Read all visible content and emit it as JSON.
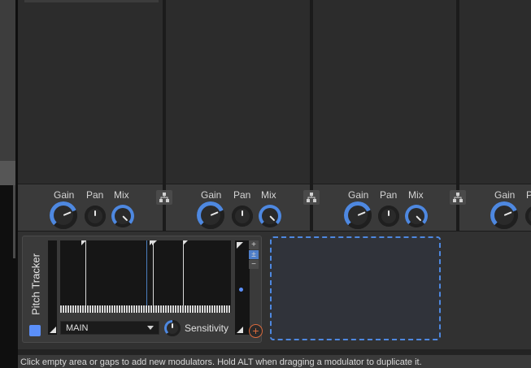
{
  "devices": [
    {
      "gain_label": "Gain",
      "pan_label": "Pan",
      "mix_label": "Mix",
      "gain": 0.75,
      "pan": 0.5,
      "mix": 1.0
    },
    {
      "gain_label": "Gain",
      "pan_label": "Pan",
      "mix_label": "Mix",
      "gain": 0.75,
      "pan": 0.5,
      "mix": 1.0
    },
    {
      "gain_label": "Gain",
      "pan_label": "Pan",
      "mix_label": "Mix",
      "gain": 0.75,
      "pan": 0.5,
      "mix": 1.0
    },
    {
      "gain_label": "Gain",
      "pan_label": "P",
      "gain": 0.75
    }
  ],
  "modulator": {
    "name": "Pitch Tracker",
    "enabled": true,
    "source_select": "MAIN",
    "sensitivity_label": "Sensitivity",
    "add_button": "+",
    "plus_label": "+",
    "mod_label": "±",
    "minus_label": "−"
  },
  "status_bar": {
    "text": "Click empty area or gaps to add new modulators. Hold ALT when dragging a modulator to duplicate it."
  },
  "colors": {
    "accent": "#5b8ff9",
    "add": "#d96a3c",
    "knob_ring": "#4e88e0"
  }
}
